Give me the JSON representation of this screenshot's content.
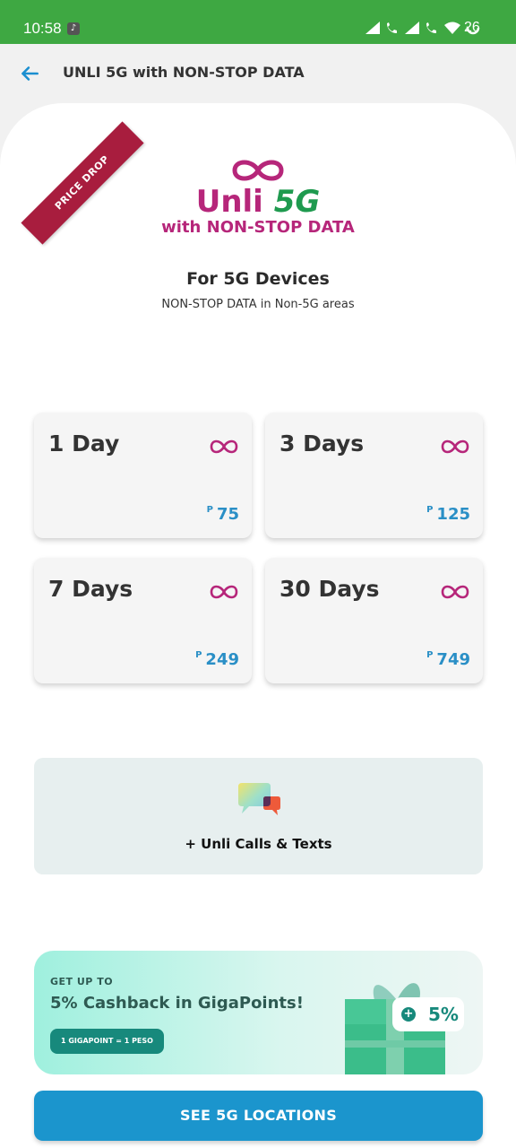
{
  "status_bar": {
    "time": "10:58",
    "battery": "26"
  },
  "appbar": {
    "title": "UNLI 5G with NON-STOP DATA"
  },
  "promo": {
    "ribbon": "PRICE DROP",
    "brand_unli": "Unli",
    "brand_5g": "5G",
    "brand_sub": "with NON-STOP DATA",
    "devices_heading": "For 5G Devices",
    "devices_sub": "NON-STOP DATA in Non-5G areas"
  },
  "plans": [
    {
      "days": "1 Day",
      "currency": "P",
      "price": "75"
    },
    {
      "days": "3 Days",
      "currency": "P",
      "price": "125"
    },
    {
      "days": "7 Days",
      "currency": "P",
      "price": "249"
    },
    {
      "days": "30 Days",
      "currency": "P",
      "price": "749"
    }
  ],
  "calls": {
    "label": "+ Unli Calls & Texts"
  },
  "cashback": {
    "up_to": "GET UP TO",
    "headline": "5% Cashback in GigaPoints!",
    "chip": "1 GIGAPOINT = 1 PESO",
    "tag_value": "5%"
  },
  "cta": {
    "label": "SEE 5G LOCATIONS"
  },
  "colors": {
    "status_bar": "#3ea842",
    "brand": "#b6267a",
    "accent_blue": "#1b95cd",
    "teal": "#17897c"
  }
}
